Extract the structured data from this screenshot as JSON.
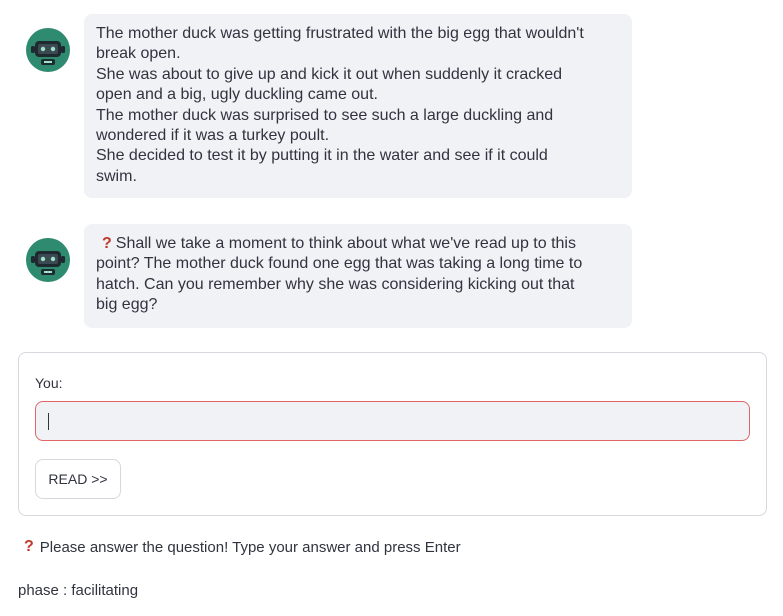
{
  "chat": {
    "messages": [
      {
        "avatar_icon": "robot-avatar-icon",
        "lines": [
          "The mother duck was getting frustrated with the big egg that wouldn't",
          "break open.",
          "She was about to give up and kick it out when suddenly it cracked",
          "open and a big, ugly duckling came out.",
          "The mother duck was surprised to see such a large duckling and",
          "wondered if it was a turkey poult.",
          "She decided to test it by putting it in the water and see if it could",
          "swim."
        ]
      },
      {
        "avatar_icon": "robot-avatar-icon",
        "question_mark": "?",
        "lines": [
          "Shall we take a moment to think about what we've read up to this",
          "point? The mother duck found one egg that was taking a long time to",
          "hatch. Can you remember why she was considering kicking out that",
          "big egg?"
        ]
      }
    ]
  },
  "form": {
    "label": "You:",
    "input_value": "",
    "read_button_label": "READ >>"
  },
  "warning": {
    "icon": "?",
    "text": "Please answer the question! Type your answer and press Enter"
  },
  "phase": {
    "text": "phase : facilitating"
  },
  "colors": {
    "bubble_bg": "#f0f2f6",
    "input_border": "#e06666",
    "question_mark": "#c0392b",
    "avatar_bg": "#2e8b6f"
  }
}
